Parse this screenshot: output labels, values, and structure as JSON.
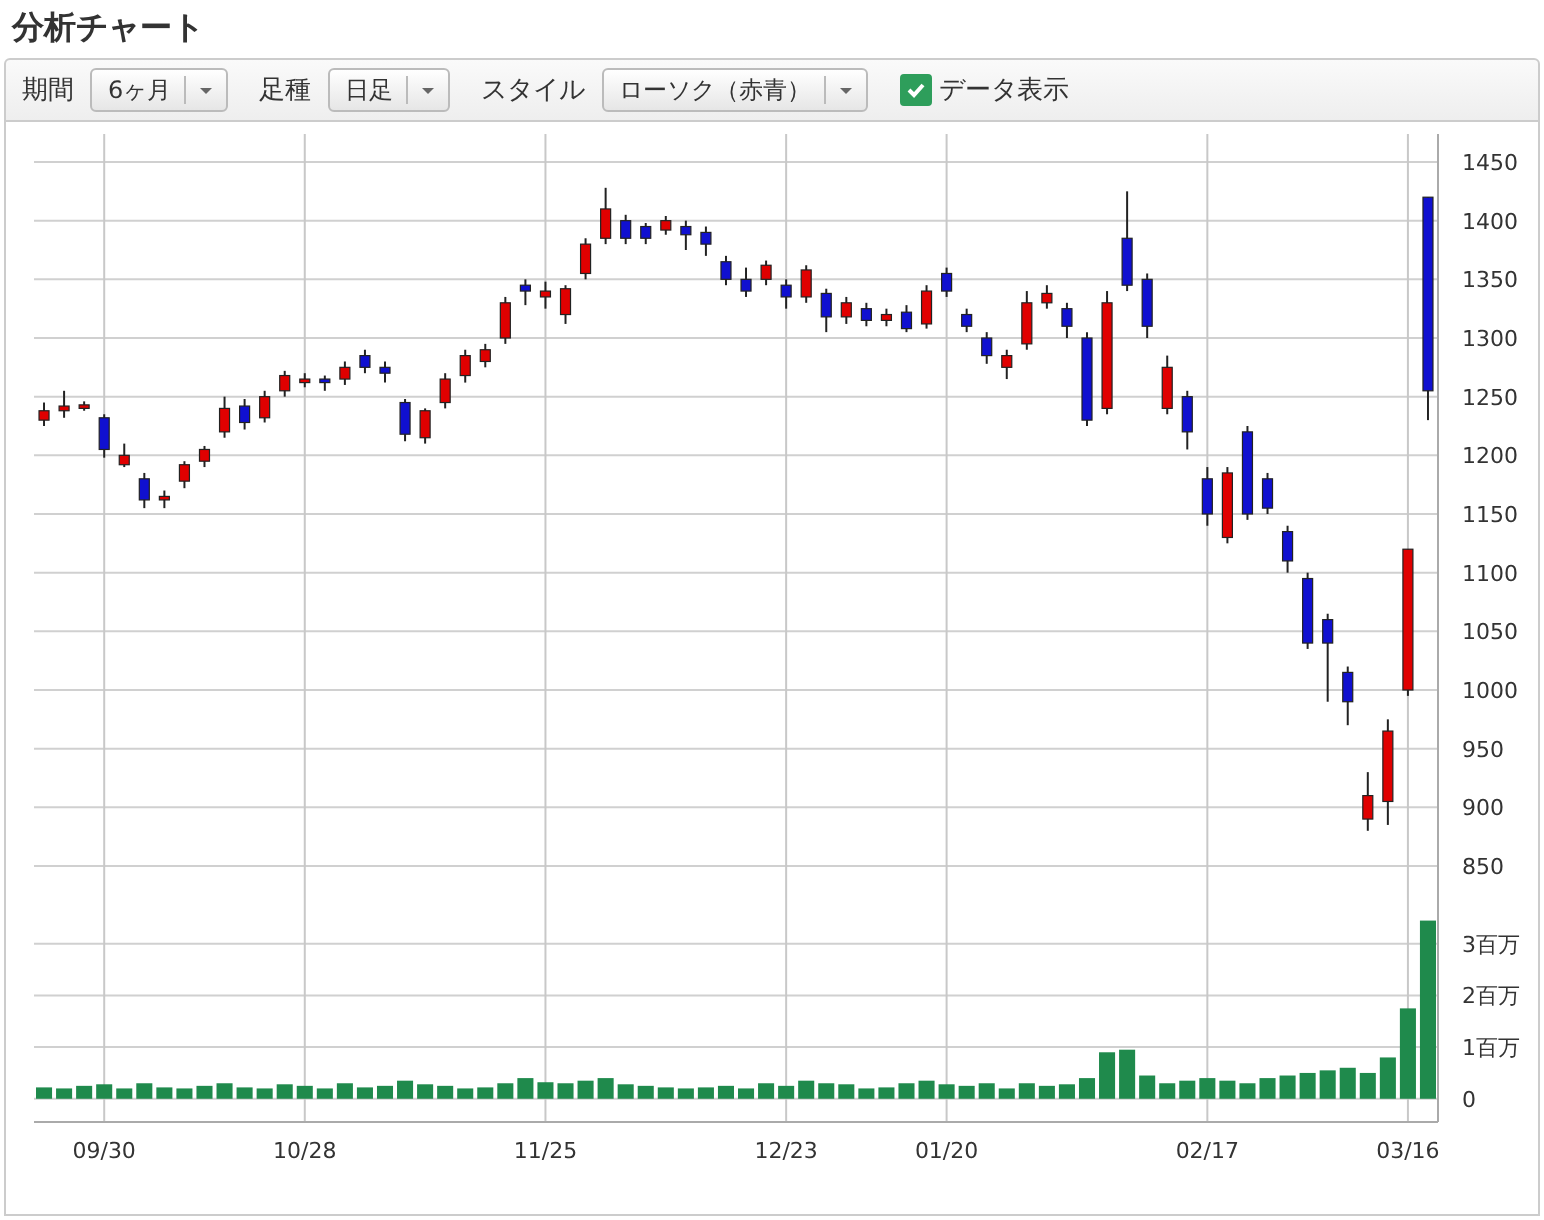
{
  "title": "分析チャート",
  "toolbar": {
    "period_label": "期間",
    "period": "6ヶ月",
    "bar_type_label": "足種",
    "bar_type": "日足",
    "style_label": "スタイル",
    "style": "ローソク（赤青）",
    "data_display": {
      "label": "データ表示",
      "checked": true
    }
  },
  "price_chart": {
    "chart_data": {
      "type": "candlestick",
      "grid": true,
      "ylim": [
        850,
        1450
      ],
      "yticks": [
        850,
        900,
        950,
        1000,
        1050,
        1100,
        1150,
        1200,
        1250,
        1300,
        1350,
        1400,
        1450
      ],
      "categories": [
        null,
        null,
        null,
        null,
        null,
        null,
        null,
        null,
        null,
        null,
        null,
        null,
        null,
        null,
        null,
        null,
        null,
        null,
        null,
        null,
        null,
        null,
        null,
        null,
        null,
        null,
        null,
        null,
        null,
        null,
        null,
        null,
        null,
        null,
        null,
        null,
        null,
        null,
        null,
        null,
        null,
        null,
        null,
        null,
        null,
        null,
        null,
        null,
        null,
        null,
        null,
        null,
        null,
        null,
        null,
        null,
        null,
        null,
        null,
        null,
        null,
        null,
        null,
        null,
        null,
        null,
        null,
        null,
        null,
        null
      ],
      "ohlc": [
        [
          1230,
          1245,
          1225,
          1238
        ],
        [
          1238,
          1255,
          1232,
          1242
        ],
        [
          1240,
          1246,
          1238,
          1243
        ],
        [
          1232,
          1235,
          1198,
          1205
        ],
        [
          1192,
          1210,
          1190,
          1200
        ],
        [
          1180,
          1185,
          1155,
          1162
        ],
        [
          1162,
          1170,
          1155,
          1165
        ],
        [
          1178,
          1195,
          1172,
          1192
        ],
        [
          1195,
          1208,
          1190,
          1205
        ],
        [
          1220,
          1250,
          1215,
          1240
        ],
        [
          1242,
          1248,
          1222,
          1228
        ],
        [
          1232,
          1255,
          1228,
          1250
        ],
        [
          1255,
          1272,
          1250,
          1268
        ],
        [
          1262,
          1270,
          1258,
          1265
        ],
        [
          1265,
          1268,
          1255,
          1262
        ],
        [
          1265,
          1280,
          1260,
          1275
        ],
        [
          1285,
          1290,
          1270,
          1275
        ],
        [
          1275,
          1280,
          1262,
          1270
        ],
        [
          1245,
          1248,
          1212,
          1218
        ],
        [
          1215,
          1240,
          1210,
          1238
        ],
        [
          1245,
          1270,
          1240,
          1265
        ],
        [
          1268,
          1290,
          1262,
          1285
        ],
        [
          1280,
          1295,
          1275,
          1290
        ],
        [
          1300,
          1335,
          1295,
          1330
        ],
        [
          1345,
          1350,
          1328,
          1340
        ],
        [
          1335,
          1348,
          1325,
          1340
        ],
        [
          1320,
          1345,
          1312,
          1342
        ],
        [
          1355,
          1385,
          1350,
          1380
        ],
        [
          1385,
          1428,
          1380,
          1410
        ],
        [
          1400,
          1405,
          1380,
          1385
        ],
        [
          1395,
          1398,
          1380,
          1385
        ],
        [
          1392,
          1404,
          1388,
          1400
        ],
        [
          1395,
          1400,
          1375,
          1388
        ],
        [
          1390,
          1395,
          1370,
          1380
        ],
        [
          1365,
          1370,
          1345,
          1350
        ],
        [
          1350,
          1360,
          1335,
          1340
        ],
        [
          1350,
          1366,
          1345,
          1362
        ],
        [
          1345,
          1350,
          1325,
          1335
        ],
        [
          1335,
          1362,
          1330,
          1358
        ],
        [
          1338,
          1342,
          1305,
          1318
        ],
        [
          1318,
          1335,
          1312,
          1330
        ],
        [
          1325,
          1330,
          1310,
          1315
        ],
        [
          1315,
          1325,
          1310,
          1320
        ],
        [
          1322,
          1328,
          1305,
          1308
        ],
        [
          1312,
          1345,
          1308,
          1340
        ],
        [
          1355,
          1360,
          1335,
          1340
        ],
        [
          1320,
          1325,
          1305,
          1310
        ],
        [
          1300,
          1305,
          1278,
          1285
        ],
        [
          1275,
          1290,
          1265,
          1285
        ],
        [
          1295,
          1340,
          1290,
          1330
        ],
        [
          1330,
          1345,
          1325,
          1338
        ],
        [
          1325,
          1330,
          1300,
          1310
        ],
        [
          1300,
          1305,
          1225,
          1230
        ],
        [
          1240,
          1340,
          1235,
          1330
        ],
        [
          1385,
          1425,
          1340,
          1345
        ],
        [
          1350,
          1355,
          1300,
          1310
        ],
        [
          1240,
          1285,
          1235,
          1275
        ],
        [
          1250,
          1255,
          1205,
          1220
        ],
        [
          1180,
          1190,
          1140,
          1150
        ],
        [
          1130,
          1190,
          1125,
          1185
        ],
        [
          1220,
          1225,
          1145,
          1150
        ],
        [
          1180,
          1185,
          1150,
          1155
        ],
        [
          1135,
          1140,
          1100,
          1110
        ],
        [
          1095,
          1100,
          1035,
          1040
        ],
        [
          1060,
          1065,
          990,
          1040
        ],
        [
          1015,
          1020,
          970,
          990
        ],
        [
          890,
          930,
          880,
          910
        ],
        [
          905,
          975,
          885,
          965
        ],
        [
          1000,
          1120,
          995,
          1120
        ],
        [
          1420,
          1420,
          1230,
          1255
        ]
      ]
    }
  },
  "volume_chart": {
    "chart_data": {
      "type": "bar",
      "grid": true,
      "ylim": [
        -0.45,
        3.5
      ],
      "yticks": [
        {
          "value": 0,
          "label": "0"
        },
        {
          "value": 1,
          "label": "1百万"
        },
        {
          "value": 2,
          "label": "2百万"
        },
        {
          "value": 3,
          "label": "3百万"
        }
      ],
      "categories": [
        null,
        null,
        null,
        "09/30",
        null,
        null,
        null,
        null,
        null,
        null,
        null,
        null,
        null,
        "10/28",
        null,
        null,
        null,
        null,
        null,
        null,
        null,
        null,
        null,
        null,
        null,
        "11/25",
        null,
        null,
        null,
        null,
        null,
        null,
        null,
        null,
        null,
        null,
        null,
        "12/23",
        null,
        null,
        null,
        null,
        null,
        null,
        null,
        "01/20",
        null,
        null,
        null,
        null,
        null,
        null,
        null,
        null,
        null,
        null,
        null,
        null,
        "02/17",
        null,
        null,
        null,
        null,
        null,
        null,
        null,
        null,
        null,
        "03/16",
        null
      ],
      "series": [
        {
          "color": "#1f8a4c",
          "values": [
            0.22,
            0.2,
            0.25,
            0.28,
            0.2,
            0.3,
            0.22,
            0.2,
            0.25,
            0.3,
            0.22,
            0.2,
            0.28,
            0.25,
            0.2,
            0.3,
            0.22,
            0.25,
            0.35,
            0.28,
            0.25,
            0.2,
            0.22,
            0.3,
            0.4,
            0.32,
            0.3,
            0.35,
            0.4,
            0.28,
            0.25,
            0.22,
            0.2,
            0.22,
            0.25,
            0.2,
            0.3,
            0.25,
            0.35,
            0.3,
            0.28,
            0.2,
            0.22,
            0.3,
            0.35,
            0.28,
            0.25,
            0.3,
            0.2,
            0.3,
            0.25,
            0.28,
            0.4,
            0.9,
            0.95,
            0.45,
            0.3,
            0.35,
            0.4,
            0.35,
            0.3,
            0.4,
            0.45,
            0.5,
            0.55,
            0.6,
            0.5,
            0.8,
            1.75,
            3.45
          ]
        }
      ]
    }
  }
}
